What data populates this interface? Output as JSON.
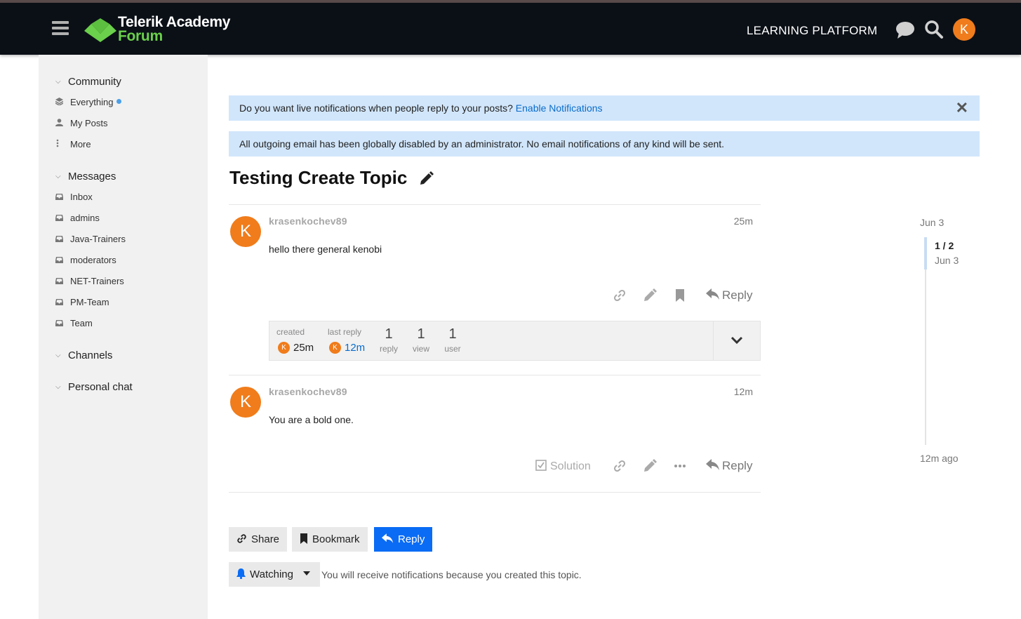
{
  "header": {
    "logo_line1": "Telerik Academy",
    "logo_line2": "Forum",
    "nav_link": "LEARNING PLATFORM",
    "avatar_letter": "K"
  },
  "sidebar": {
    "community": {
      "title": "Community",
      "items": [
        {
          "label": "Everything",
          "icon": "layers-icon"
        },
        {
          "label": "My Posts",
          "icon": "user-icon"
        },
        {
          "label": "More",
          "icon": "vertical-ellipsis-icon"
        }
      ]
    },
    "messages": {
      "title": "Messages",
      "items": [
        {
          "label": "Inbox"
        },
        {
          "label": "admins"
        },
        {
          "label": "Java-Trainers"
        },
        {
          "label": "moderators"
        },
        {
          "label": "NET-Trainers"
        },
        {
          "label": "PM-Team"
        },
        {
          "label": "Team"
        }
      ]
    },
    "channels": {
      "title": "Channels"
    },
    "personal_chat": {
      "title": "Personal chat"
    }
  },
  "notices": {
    "notifications_text": "Do you want live notifications when people reply to your posts?",
    "notifications_link": "Enable Notifications",
    "email_disabled": "All outgoing email has been globally disabled by an administrator. No email notifications of any kind will be sent."
  },
  "topic": {
    "title": "Testing Create Topic"
  },
  "posts": [
    {
      "avatar_letter": "K",
      "username": "krasenkochev89",
      "time": "25m",
      "body": "hello there general kenobi",
      "reply_label": "Reply"
    },
    {
      "avatar_letter": "K",
      "username": "krasenkochev89",
      "time": "12m",
      "body": "You are a bold one.",
      "solution_label": "Solution",
      "reply_label": "Reply"
    }
  ],
  "summary": {
    "created_label": "created",
    "created_value": "25m",
    "created_avatar": "K",
    "last_reply_label": "last reply",
    "last_reply_value": "12m",
    "last_reply_avatar": "K",
    "replies_count": "1",
    "replies_label": "reply",
    "views_count": "1",
    "views_label": "view",
    "users_count": "1",
    "users_label": "user"
  },
  "timeline": {
    "start_date": "Jun 3",
    "position": "1 / 2",
    "position_date": "Jun 3",
    "end_label": "12m ago"
  },
  "footer_buttons": {
    "share": "Share",
    "bookmark": "Bookmark",
    "reply": "Reply",
    "watching": "Watching",
    "watching_note": "You will receive notifications because you created this topic."
  },
  "colors": {
    "header_bg": "#0b1017",
    "accent_green": "#6bd04b",
    "avatar_orange": "#f07c1b",
    "primary_blue": "#0a6cf5",
    "notice_bg": "#d1e6fb",
    "sidebar_bg": "#f1f1f1"
  }
}
